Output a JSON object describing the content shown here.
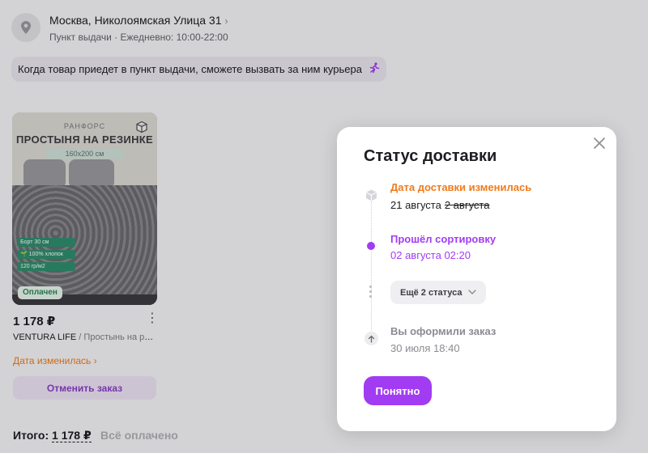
{
  "address": {
    "title": "Москва, Николоямская Улица 31",
    "chevron": "›",
    "subtitle": "Пункт выдачи · Ежедневно: 10:00-22:00",
    "icon": "location-pin-icon"
  },
  "courier_banner": {
    "text": "Когда товар приедет в пункт выдачи, сможете вызвать за ним курьера",
    "icon": "running-courier-icon"
  },
  "product": {
    "image": {
      "brand_text": "РАНФОРС",
      "title_text": "ПРОСТЫНЯ НА РЕЗИНКЕ",
      "size_text": "160х200 см",
      "tags": [
        "Борт 30 см",
        "🌱 100% хлопок",
        "120 гр/м2"
      ]
    },
    "paid_badge": "Оплачен",
    "price": "1 178 ₽",
    "seller": "VENTURA LIFE",
    "seller_separator": " / ",
    "name": "Простынь на резинке",
    "date_changed": "Дата изменилась",
    "date_changed_chevron": "›",
    "cancel_label": "Отменить заказ"
  },
  "summary": {
    "total_label": "Итого:",
    "total_value": "1 178 ₽",
    "paid_label": "Всё оплачено"
  },
  "modal": {
    "title": "Статус доставки",
    "events": [
      {
        "title": "Дата доставки изменилась",
        "new_date": "21 августа",
        "old_date": "2 августа",
        "icon": "package-box-icon"
      },
      {
        "title": "Прошёл сортировку",
        "date": "02 августа 02:20"
      },
      {
        "title": "Вы оформили заказ",
        "date": "30 июля 18:40",
        "icon": "arrow-up-icon"
      }
    ],
    "more_label": "Ещё 2 статуса",
    "ok_label": "Понятно"
  },
  "colors": {
    "accent_purple": "#a23cf2",
    "warning_orange": "#ef7b1c",
    "success_green": "#2a8a57"
  }
}
